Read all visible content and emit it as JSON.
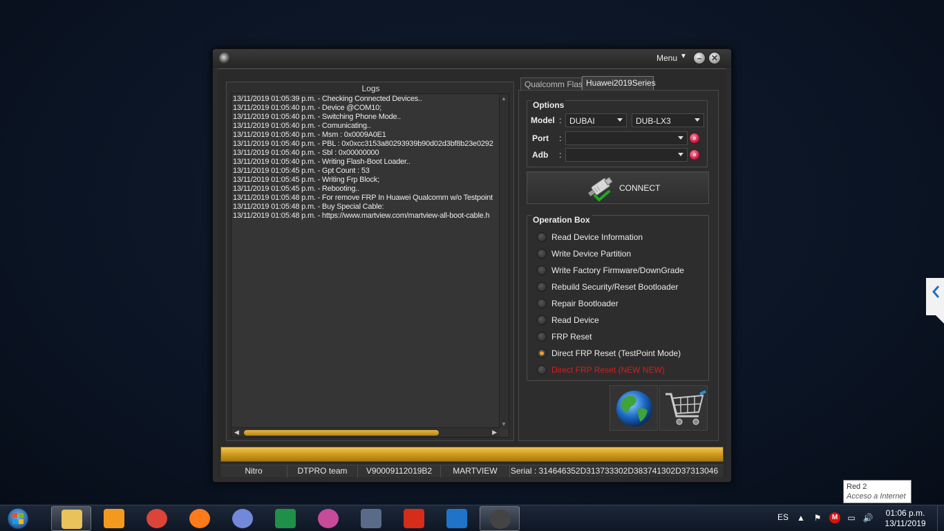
{
  "window": {
    "menu_label": "Menu",
    "logs_title": "Logs",
    "logs": [
      "13/11/2019 01:05:39 p.m. - Checking Connected Devices..",
      "13/11/2019 01:05:40 p.m. - Device @COM10;",
      "13/11/2019 01:05:40 p.m. - Switching Phone Mode..",
      "13/11/2019 01:05:40 p.m. - Comunicating..",
      "13/11/2019 01:05:40 p.m. - Msm : 0x0009A0E1",
      "13/11/2019 01:05:40 p.m. - PBL : 0x0xcc3153a80293939b90d02d3bf8b23e0292",
      "13/11/2019 01:05:40 p.m. - Sbl : 0x00000000",
      "13/11/2019 01:05:40 p.m. - Writing Flash-Boot Loader..",
      "13/11/2019 01:05:45 p.m. - Gpt Count : 53",
      "13/11/2019 01:05:45 p.m. - Writing Frp Block;",
      "13/11/2019 01:05:45 p.m. - Rebooting..",
      "13/11/2019 01:05:48 p.m. - For remove FRP In Huawei Qualcomm w/o Testpoint",
      "13/11/2019 01:05:48 p.m. - Buy Special Cable:",
      "13/11/2019 01:05:48 p.m. - https://www.martview.com/martview-all-boot-cable.h"
    ],
    "tabs": [
      "Qualcomm Flash",
      "Huawei2019Series"
    ],
    "options": {
      "title": "Options",
      "model_label": "Model",
      "model_value": "DUBAI",
      "variant_value": "DUB-LX3",
      "port_label": "Port",
      "port_value": "",
      "adb_label": "Adb",
      "adb_value": ""
    },
    "connect_label": "CONNECT",
    "operation_box": {
      "title": "Operation Box",
      "items": [
        "Read Device Information",
        "Write Device Partition",
        "Write Factory Firmware/DownGrade",
        "Rebuild Security/Reset Bootloader",
        "Repair Bootloader",
        "Read Device",
        "FRP Reset",
        "Direct FRP Reset (TestPoint Mode)",
        "Direct FRP Reset (NEW NEW)"
      ],
      "selected_index": 7,
      "highlight_color": "#e01a1a"
    },
    "progress": 1.0,
    "status": [
      "Nitro",
      "DTPRO team",
      "V90009112019B2",
      "MARTVIEW",
      "Serial : 314646352D313733302D383741302D37313046"
    ],
    "accent_color": "#d9a628"
  },
  "tooltip": {
    "line1": "Red  2",
    "line2": "Acceso a Internet"
  },
  "taskbar": {
    "apps": [
      "file-explorer-icon",
      "media-player-icon",
      "chrome-icon",
      "firefox-icon",
      "discord-icon",
      "excel-icon",
      "browser-swirl-icon",
      "camera-app-icon",
      "filezilla-icon",
      "remote-desktop-icon",
      "martview-icon"
    ],
    "language": "ES",
    "time": "01:06 p.m.",
    "date": "13/11/2019"
  }
}
